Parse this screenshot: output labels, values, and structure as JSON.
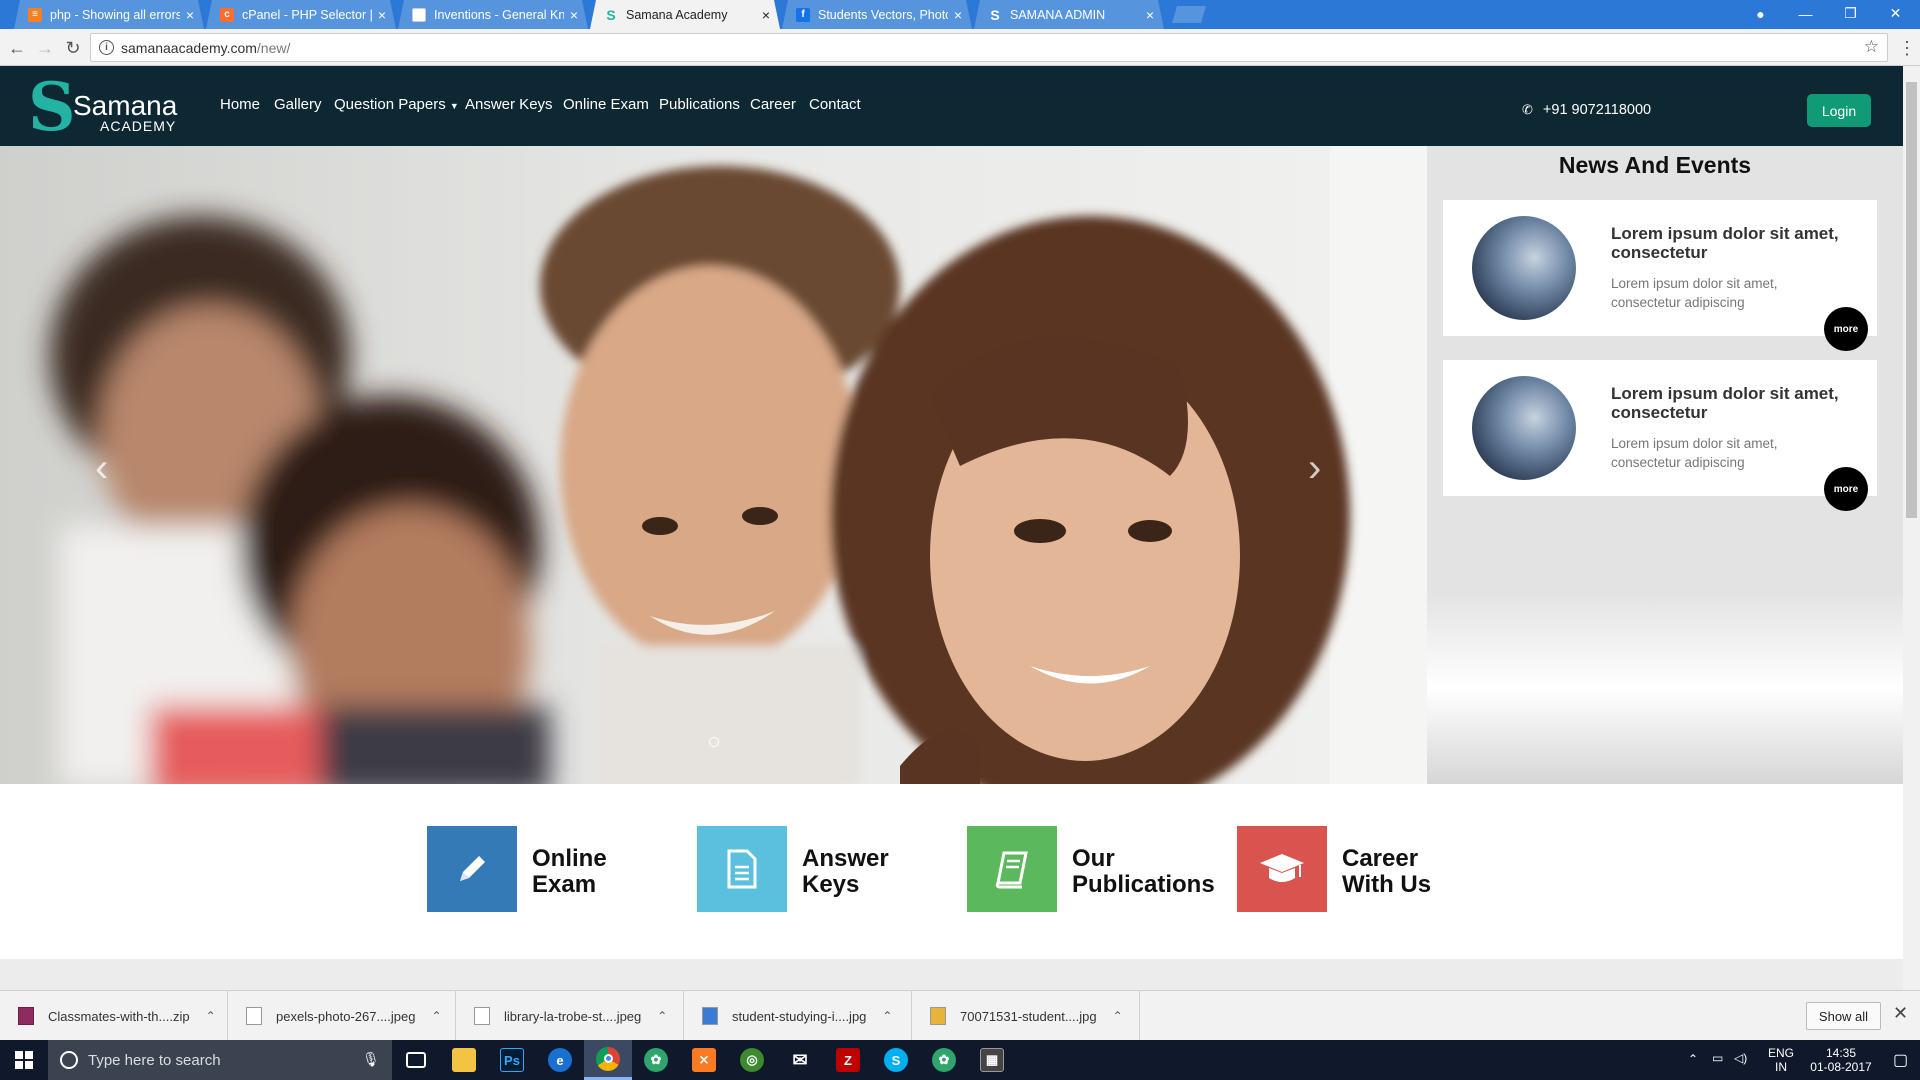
{
  "browser": {
    "tabs": [
      {
        "title": "php - Showing all errors",
        "favicon": "page-icon"
      },
      {
        "title": "cPanel - PHP Selector | e",
        "favicon": "cpanel-icon"
      },
      {
        "title": "Inventions - General Kno",
        "favicon": "page-icon"
      },
      {
        "title": "Samana Academy",
        "favicon": "samana-icon",
        "active": true
      },
      {
        "title": "Students Vectors, Photos",
        "favicon": "freepik-icon"
      },
      {
        "title": "SAMANA ADMIN",
        "favicon": "samana-icon"
      }
    ],
    "url_host": "samanaacademy.com",
    "url_path": "/new/"
  },
  "site": {
    "logo_name": "Samana",
    "logo_sub": "ACADEMY",
    "nav": [
      "Home",
      "Gallery",
      "Question Papers",
      "Answer Keys",
      "Online Exam",
      "Publications",
      "Career",
      "Contact"
    ],
    "phone": "+91 9072118000",
    "login_label": "Login"
  },
  "news": {
    "title": "News And Events",
    "items": [
      {
        "title": "Lorem ipsum dolor sit amet, consectetur",
        "text": "Lorem ipsum dolor sit amet, consectetur adipiscing",
        "more": "more"
      },
      {
        "title": "Lorem ipsum dolor sit amet, consectetur",
        "text": "Lorem ipsum dolor sit amet, consectetur adipiscing",
        "more": "more"
      }
    ]
  },
  "features": [
    {
      "label": "Online\nExam",
      "color": "#337ab7",
      "icon": "pencil-icon"
    },
    {
      "label": "Answer\nKeys",
      "color": "#5bc0de",
      "icon": "document-icon"
    },
    {
      "label": "Our\nPublications",
      "color": "#5cb85c",
      "icon": "book-icon"
    },
    {
      "label": "Career\nWith Us",
      "color": "#d9534f",
      "icon": "graduation-cap-icon"
    }
  ],
  "downloads": [
    {
      "name": "Classmates-with-th....zip"
    },
    {
      "name": "pexels-photo-267....jpeg"
    },
    {
      "name": "library-la-trobe-st....jpeg"
    },
    {
      "name": "student-studying-i....jpg"
    },
    {
      "name": "70071531-student....jpg"
    }
  ],
  "downloads_show_all": "Show all",
  "taskbar": {
    "search_placeholder": "Type here to search",
    "lang": "ENG",
    "region": "IN",
    "time": "14:35",
    "date": "01-08-2017"
  }
}
